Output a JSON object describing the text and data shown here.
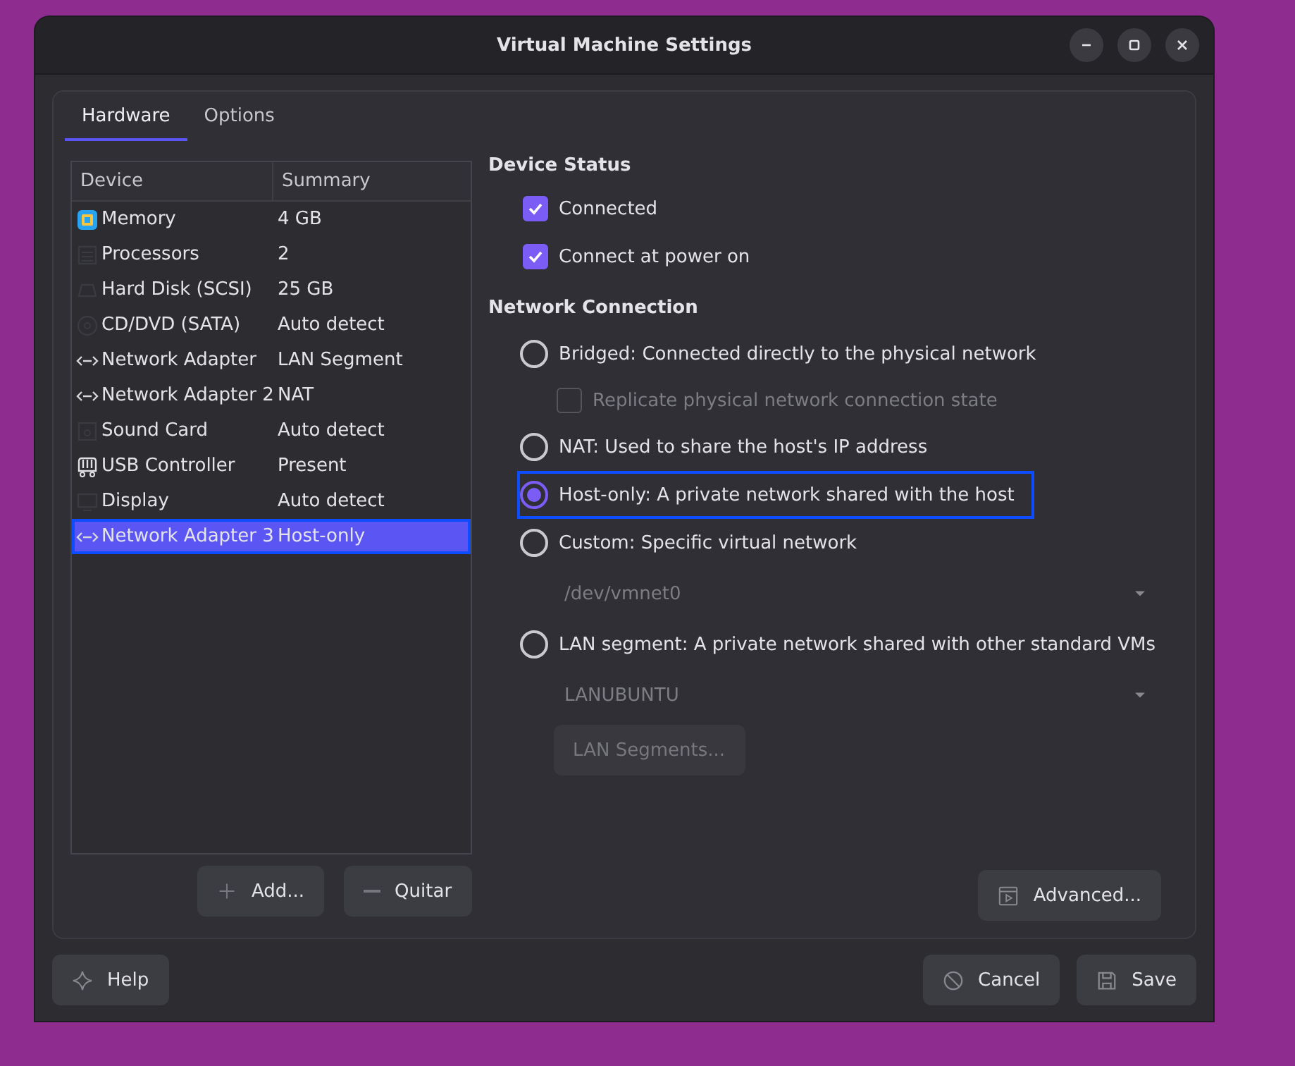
{
  "window": {
    "title": "Virtual Machine Settings"
  },
  "tabs": [
    {
      "label": "Hardware",
      "selected": true
    },
    {
      "label": "Options",
      "selected": false
    }
  ],
  "device_table": {
    "columns": [
      "Device",
      "Summary"
    ],
    "rows": [
      {
        "kind": "memory",
        "device": "Memory",
        "summary": "4 GB",
        "selected": false,
        "highlighted": false
      },
      {
        "kind": "processor",
        "device": "Processors",
        "summary": "2",
        "selected": false,
        "highlighted": false
      },
      {
        "kind": "disk",
        "device": "Hard Disk (SCSI)",
        "summary": "25 GB",
        "selected": false,
        "highlighted": false
      },
      {
        "kind": "cdrom",
        "device": "CD/DVD (SATA)",
        "summary": "Auto detect",
        "selected": false,
        "highlighted": false
      },
      {
        "kind": "network",
        "device": "Network Adapter",
        "summary": "LAN Segment",
        "selected": false,
        "highlighted": false
      },
      {
        "kind": "network",
        "device": "Network Adapter 2",
        "summary": "NAT",
        "selected": false,
        "highlighted": false
      },
      {
        "kind": "sound",
        "device": "Sound Card",
        "summary": "Auto detect",
        "selected": false,
        "highlighted": false
      },
      {
        "kind": "usb",
        "device": "USB Controller",
        "summary": "Present",
        "selected": false,
        "highlighted": false
      },
      {
        "kind": "display",
        "device": "Display",
        "summary": "Auto detect",
        "selected": false,
        "highlighted": false
      },
      {
        "kind": "network",
        "device": "Network Adapter 3",
        "summary": "Host-only",
        "selected": true,
        "highlighted": true
      }
    ]
  },
  "list_buttons": [
    {
      "kind": "add",
      "label": "Add..."
    },
    {
      "kind": "remove",
      "label": "Quitar"
    }
  ],
  "device_status": {
    "heading": "Device Status",
    "options": [
      {
        "label": "Connected",
        "checked": true
      },
      {
        "label": "Connect at power on",
        "checked": true
      }
    ]
  },
  "network_connection": {
    "heading": "Network Connection",
    "options": [
      {
        "kind": "radio",
        "label": "Bridged: Connected directly to the physical network",
        "selected": false,
        "highlighted": false
      },
      {
        "kind": "checkbox",
        "label": "Replicate physical network connection state",
        "checked": false,
        "disabled": true
      },
      {
        "kind": "radio",
        "label": "NAT: Used to share the host's IP address",
        "selected": false,
        "highlighted": false
      },
      {
        "kind": "radio",
        "label": "Host-only: A private network shared with the host",
        "selected": true,
        "highlighted": true
      },
      {
        "kind": "radio",
        "label": "Custom: Specific virtual network",
        "selected": false,
        "highlighted": false
      },
      {
        "kind": "dropdown",
        "value": "/dev/vmnet0",
        "disabled": true
      },
      {
        "kind": "radio",
        "label": "LAN segment: A private network shared with other standard VMs",
        "selected": false,
        "highlighted": false
      },
      {
        "kind": "dropdown",
        "value": "LANUBUNTU",
        "disabled": true
      },
      {
        "kind": "button",
        "label": "LAN Segments...",
        "disabled": true
      }
    ]
  },
  "advanced_button": {
    "label": "Advanced..."
  },
  "footer_buttons": [
    {
      "kind": "help",
      "label": "Help"
    },
    {
      "kind": "cancel",
      "label": "Cancel"
    },
    {
      "kind": "save",
      "label": "Save"
    }
  ]
}
